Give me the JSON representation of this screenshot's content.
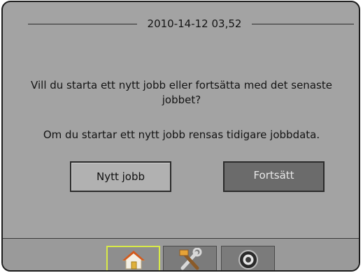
{
  "header": {
    "datetime": "2010-14-12 03,52"
  },
  "dialog": {
    "question": "Vill du starta ett nytt jobb eller fortsätta med det senaste jobbet?",
    "info": "Om du startar ett nytt jobb rensas tidigare jobbdata."
  },
  "buttons": {
    "new_job": "Nytt jobb",
    "continue": "Fortsätt"
  },
  "nav": {
    "tabs": [
      {
        "icon": "home-icon",
        "selected": true
      },
      {
        "icon": "tools-icon",
        "selected": false
      },
      {
        "icon": "camera-icon",
        "selected": false
      }
    ]
  },
  "colors": {
    "background": "#a3a3a3",
    "selected_tab_border": "#d8ea48",
    "continue_button": "#6b6b6b"
  }
}
